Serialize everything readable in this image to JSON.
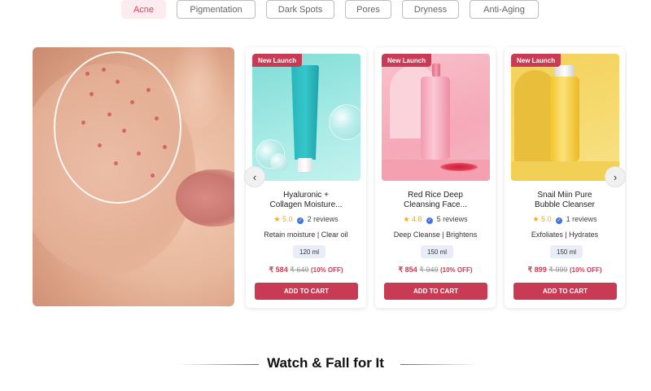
{
  "tabs": [
    {
      "label": "Acne",
      "active": true
    },
    {
      "label": "Pigmentation",
      "active": false
    },
    {
      "label": "Dark Spots",
      "active": false
    },
    {
      "label": "Pores",
      "active": false
    },
    {
      "label": "Dryness",
      "active": false
    },
    {
      "label": "Anti-Aging",
      "active": false
    }
  ],
  "carousel": {
    "prev_icon": "chevron-left-icon",
    "next_icon": "chevron-right-icon",
    "prev_glyph": "‹",
    "next_glyph": "›"
  },
  "products": [
    {
      "badge": "New Launch",
      "name_line1": "Hyaluronic +",
      "name_line2": "Collagen Moisture...",
      "rating": "5.0",
      "reviews": "2 reviews",
      "tags": "Retain moisture | Clear oil",
      "size": "120 ml",
      "price": "₹ 584",
      "mrp": "₹ 649",
      "discount": "(10% OFF)",
      "cart_label": "ADD TO CART"
    },
    {
      "badge": "New Launch",
      "name_line1": "Red Rice Deep",
      "name_line2": "Cleansing Face...",
      "rating": "4.8",
      "reviews": "5 reviews",
      "tags": "Deep Cleanse | Brightens",
      "size": "150 ml",
      "price": "₹ 854",
      "mrp": "₹ 949",
      "discount": "(10% OFF)",
      "cart_label": "ADD TO CART"
    },
    {
      "badge": "New Launch",
      "name_line1": "Snail Miin Pure",
      "name_line2": "Bubble Cleanser",
      "rating": "5.0",
      "reviews": "1 reviews",
      "tags": "Exfoliates | Hydrates",
      "size": "150 ml",
      "price": "₹ 899",
      "mrp": "₹ 999",
      "discount": "(10% OFF)",
      "cart_label": "ADD TO CART"
    }
  ],
  "section": {
    "title": "Watch & Fall for It"
  },
  "colors": {
    "accent": "#c93a55",
    "tab_active_bg": "#fdecef"
  }
}
